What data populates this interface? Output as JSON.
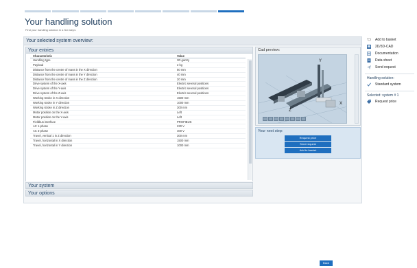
{
  "header": {
    "title": "Your handling solution",
    "subtitle": "Find your handling solution in a few steps"
  },
  "progress": {
    "total_steps": 8,
    "current_step": 8
  },
  "overview": {
    "title": "Your selected system overview:",
    "entries_label": "Your entries",
    "columns": [
      "Characteristic",
      "Value"
    ],
    "rows": [
      [
        "Handling type",
        "3D gantry"
      ],
      [
        "Payload",
        "2 kg"
      ],
      [
        "Distance from the centre of mass in the X direction",
        "50 mm"
      ],
      [
        "Distance from the centre of mass in the Y direction",
        "40 mm"
      ],
      [
        "Distance from the centre of mass in the Z direction",
        "20 mm"
      ],
      [
        "Drive system of the X-axis",
        "Electric several positions"
      ],
      [
        "Drive system of the Y-axis",
        "Electric several positions"
      ],
      [
        "Drive system of the Z-axis",
        "Electric several positions"
      ],
      [
        "Working stroke in X direction",
        "1500 mm"
      ],
      [
        "Working stroke in Y direction",
        "1000 mm"
      ],
      [
        "Working stroke in Z direction",
        "300 mm"
      ],
      [
        "Motor position on the X-axis",
        "Left"
      ],
      [
        "Motor position on the Y-axis",
        "Left"
      ],
      [
        "Fieldbus interface",
        "PROFIBUS"
      ],
      [
        "AC 1-phase",
        "230 V"
      ],
      [
        "AC 3-phase",
        "400 V"
      ],
      [
        "Travel, vertical 1 in Z direction",
        "300 mm"
      ],
      [
        "Travel, horizontal in X direction",
        "1500 mm"
      ],
      [
        "Travel, horizontal in Y direction",
        "1000 mm"
      ]
    ],
    "system_label": "Your system",
    "options_label": "Your options"
  },
  "cad": {
    "label": "Cad preview:",
    "axis_y": "Y",
    "axis_z": "Z",
    "axis_x": "X"
  },
  "next_step": {
    "label": "Your next step:",
    "buttons": [
      "Request price",
      "Send request",
      "Add to basket"
    ]
  },
  "sidebar": {
    "items": [
      "Add to basket",
      "2D/3D-CAD",
      "Documentation",
      "Data sheet",
      "Send request"
    ],
    "solution_head": "Handling solution:",
    "solution_item": "Standard system",
    "selected_head": "Selected: system # 1",
    "selected_item": "Request price"
  },
  "footer": {
    "back_label": "Back"
  },
  "colors": {
    "accent": "#1f6fbf",
    "panel": "#d9e6f2",
    "title": "#1d3c5c"
  }
}
